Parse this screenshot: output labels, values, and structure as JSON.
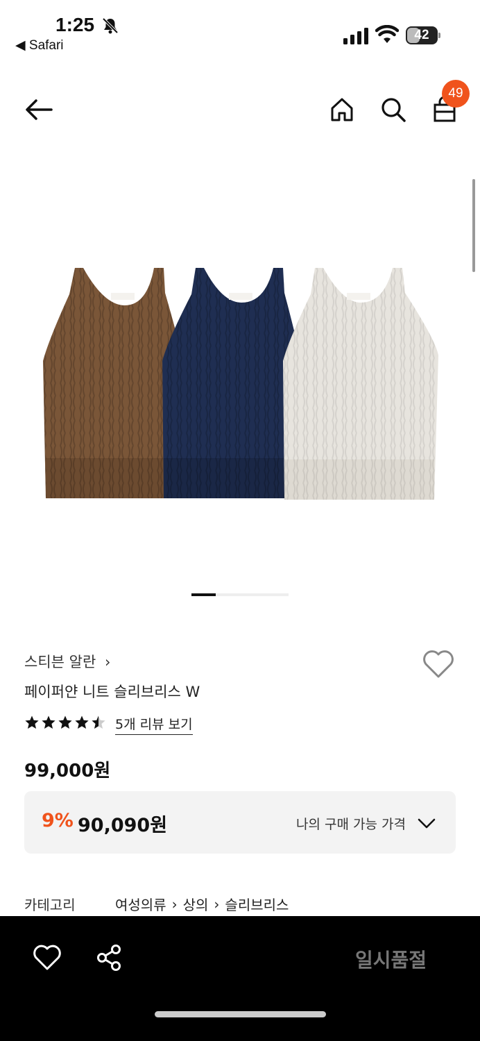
{
  "status_bar": {
    "time": "1:25",
    "back_app": "◀ Safari",
    "battery": "42",
    "battery_level": 0.42
  },
  "header": {
    "back_icon": "arrow-left-icon",
    "home_icon": "home-icon",
    "search_icon": "search-icon",
    "cart_icon": "shopping-bag-icon",
    "cart_count": "49"
  },
  "gallery": {
    "image_alt": "",
    "colors": [
      "#7a5638",
      "#1f2e52",
      "#e7e4de"
    ],
    "page_index": 1,
    "page_count": 4
  },
  "product": {
    "brand": "스티븐 알란",
    "name": "페이퍼얀 니트 슬리브리스 W",
    "rating": 4.5,
    "review_link": "5개 리뷰 보기",
    "price": "99,000원",
    "discount": "9%",
    "sale_price": "90,090원",
    "my_price_label": "나의 구매 가능 가격"
  },
  "category": {
    "label": "카테고리",
    "path": [
      "여성의류",
      "상의",
      "슬리브리스"
    ]
  },
  "bottom_bar": {
    "soldout_label": "일시품절"
  },
  "accent": "#f0531c"
}
